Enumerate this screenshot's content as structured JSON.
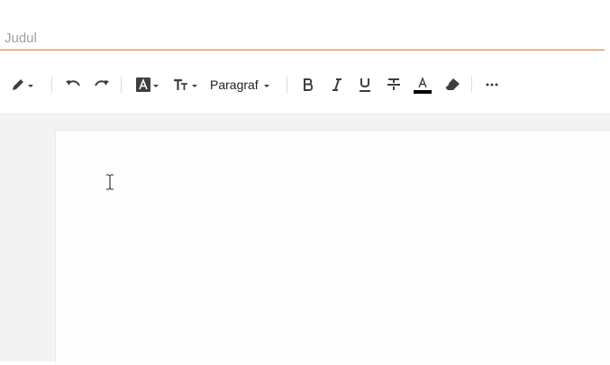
{
  "title": {
    "placeholder": "Judul",
    "value": ""
  },
  "toolbar": {
    "paragraph_label": "Paragraf"
  },
  "colors": {
    "title_underline": "#e07b2e",
    "text_color_bar": "#000000",
    "workspace_bg": "#f3f3f3",
    "page_bg": "#fdfdfd"
  },
  "icons": [
    "pen-icon",
    "undo-icon",
    "redo-icon",
    "highlight-box-icon",
    "text-size-icon",
    "bold-icon",
    "italic-icon",
    "underline-icon",
    "strikethrough-icon",
    "font-color-icon",
    "eraser-icon",
    "more-icon",
    "text-cursor-icon"
  ]
}
